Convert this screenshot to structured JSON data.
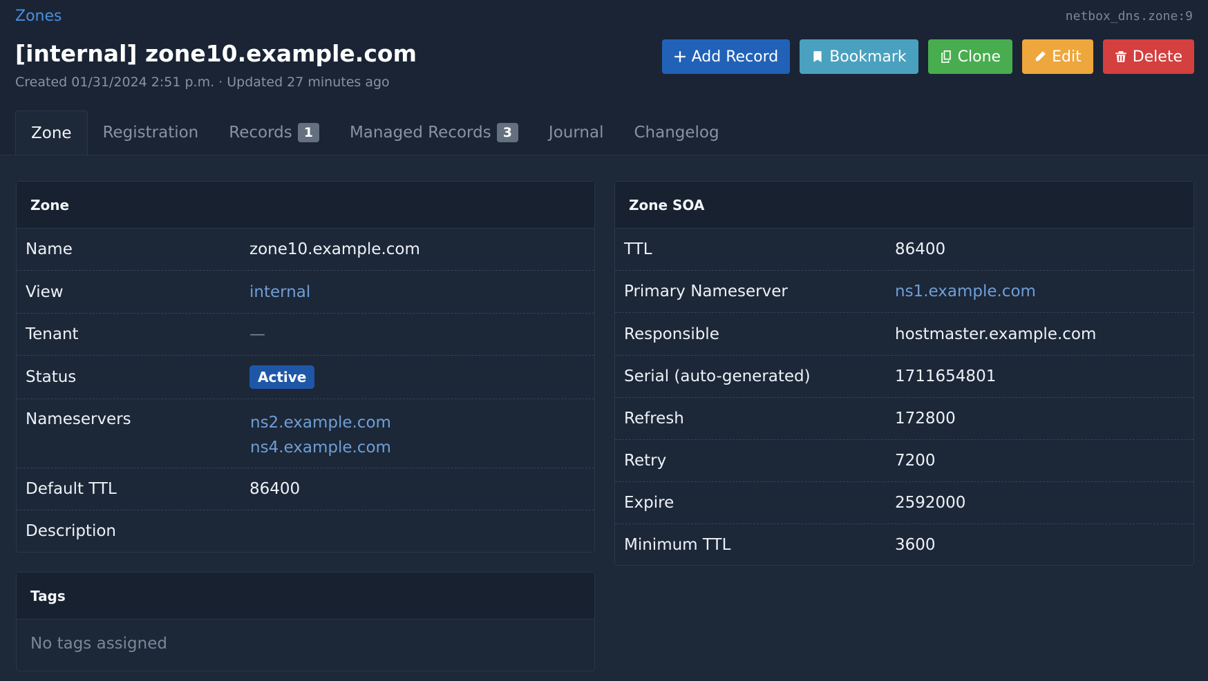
{
  "breadcrumb": "Zones",
  "object_id": "netbox_dns.zone:9",
  "title": "[internal] zone10.example.com",
  "meta": "Created 01/31/2024 2:51 p.m. · Updated 27 minutes ago",
  "actions": {
    "add_record": "Add Record",
    "bookmark": "Bookmark",
    "clone": "Clone",
    "edit": "Edit",
    "delete": "Delete"
  },
  "tabs": {
    "zone": "Zone",
    "registration": "Registration",
    "records": "Records",
    "records_count": "1",
    "managed_records": "Managed Records",
    "managed_records_count": "3",
    "journal": "Journal",
    "changelog": "Changelog"
  },
  "zone_card": {
    "title": "Zone",
    "name_label": "Name",
    "name_value": "zone10.example.com",
    "view_label": "View",
    "view_value": "internal",
    "tenant_label": "Tenant",
    "tenant_value": "—",
    "status_label": "Status",
    "status_value": "Active",
    "nameservers_label": "Nameservers",
    "nameserver_1": "ns2.example.com",
    "nameserver_2": "ns4.example.com",
    "default_ttl_label": "Default TTL",
    "default_ttl_value": "86400",
    "description_label": "Description"
  },
  "tags_card": {
    "title": "Tags",
    "empty": "No tags assigned"
  },
  "soa_card": {
    "title": "Zone SOA",
    "ttl_label": "TTL",
    "ttl_value": "86400",
    "mname_label": "Primary Nameserver",
    "mname_value": "ns1.example.com",
    "rname_label": "Responsible",
    "rname_value": "hostmaster.example.com",
    "serial_label": "Serial (auto-generated)",
    "serial_value": "1711654801",
    "refresh_label": "Refresh",
    "refresh_value": "172800",
    "retry_label": "Retry",
    "retry_value": "7200",
    "expire_label": "Expire",
    "expire_value": "2592000",
    "minimum_label": "Minimum TTL",
    "minimum_value": "3600"
  }
}
